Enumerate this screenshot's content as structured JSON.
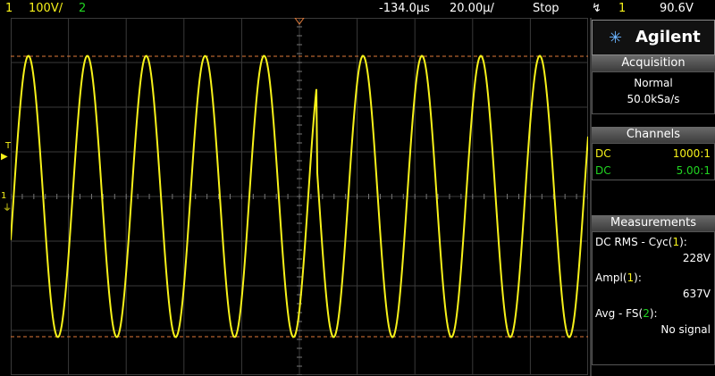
{
  "status_bar": {
    "ch1_number": "1",
    "ch1_scale": "100V/",
    "ch2_number": "2",
    "time_offset": "-134.0µs",
    "time_scale": "20.00µ/",
    "run_state": "Stop",
    "trigger_icon": "trigger-edge-icon",
    "trigger_channel": "1",
    "trigger_level": "90.6V"
  },
  "brand": {
    "logo_icon": "agilent-spark-icon",
    "name": "Agilent"
  },
  "acquisition": {
    "header": "Acquisition",
    "mode": "Normal",
    "sample_rate": "50.0kSa/s"
  },
  "channels": {
    "header": "Channels",
    "items": [
      {
        "coupling": "DC",
        "probe": "1000:1",
        "color": "#f7f21a"
      },
      {
        "coupling": "DC",
        "probe": "5.00:1",
        "color": "#21d421"
      }
    ]
  },
  "measurements": {
    "header": "Measurements",
    "items": [
      {
        "label_prefix": "DC RMS - Cyc(",
        "source": "1",
        "label_suffix": "):",
        "value": "228V"
      },
      {
        "label_prefix": "Ampl(",
        "source": "1",
        "label_suffix": "):",
        "value": "637V"
      },
      {
        "label_prefix": "Avg - FS(",
        "source": "2",
        "label_suffix": "):",
        "value": "No signal"
      }
    ]
  },
  "markers": {
    "trigger_level_label": "T",
    "ground_label": "1"
  },
  "colors": {
    "ch1": "#f7f21a",
    "ch2": "#21d421",
    "cursor": "#e07a3a",
    "grid": "#3a3a3a"
  },
  "chart_data": {
    "type": "line",
    "title": "",
    "xlabel": "",
    "ylabel": "",
    "x_divisions": 10,
    "y_divisions": 8,
    "time_per_div_us": 20.0,
    "volts_per_div": 100,
    "series": [
      {
        "waveform": "sine",
        "amplitude_divisions": 3.15,
        "cycles_on_screen": 9.8,
        "discontinuity_at_division": 5.3
      }
    ],
    "cursor_lines_divisions": [
      3.14,
      -3.14
    ]
  }
}
